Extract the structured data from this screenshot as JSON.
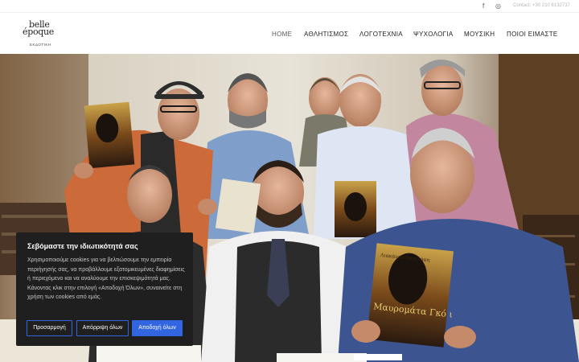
{
  "topbar": {
    "facebook_icon": "f",
    "instagram_icon": "◎",
    "contact": "Contact: +30 210 6132737"
  },
  "logo": {
    "line1": "belle",
    "line2": "époque",
    "line3": "ΕΚΔΟΤΙΚΗ"
  },
  "nav": {
    "items": [
      "HOME",
      "ΑΘΛΗΤΙΣΜΟΣ",
      "ΛΟΓΟΤΕΧΝΙΑ",
      "ΨΥΧΟΛΟΓΙΑ",
      "ΜΟΥΣΙΚΗ",
      "ΠΟΙΟΙ ΕΙΜΑΣΤΕ"
    ]
  },
  "hero": {
    "book_title": "Μαυρομάτα Γκό ι",
    "book_author": "Λιακάνου Βασιλάκη"
  },
  "cookie": {
    "title": "Σεβόμαστε την ιδιωτικότητά σας",
    "body": "Χρησιμοποιούμε cookies για να βελτιώσουμε την εμπειρία περιήγησής σας, να προβάλλουμε εξατομικευμένες διαφημίσεις ή περιεχόμενο και να αναλύουμε την επισκεψιμότητά μας. Κάνοντας κλικ στην επιλογή «Αποδοχή Όλων», συναινείτε στη χρήση των cookies από εμάς.",
    "customize": "Προσαρμογή",
    "reject": "Απόρριψη όλων",
    "accept": "Αποδοχή όλων"
  },
  "colors": {
    "accent": "#3266e0",
    "panel": "#1f1f1f"
  }
}
